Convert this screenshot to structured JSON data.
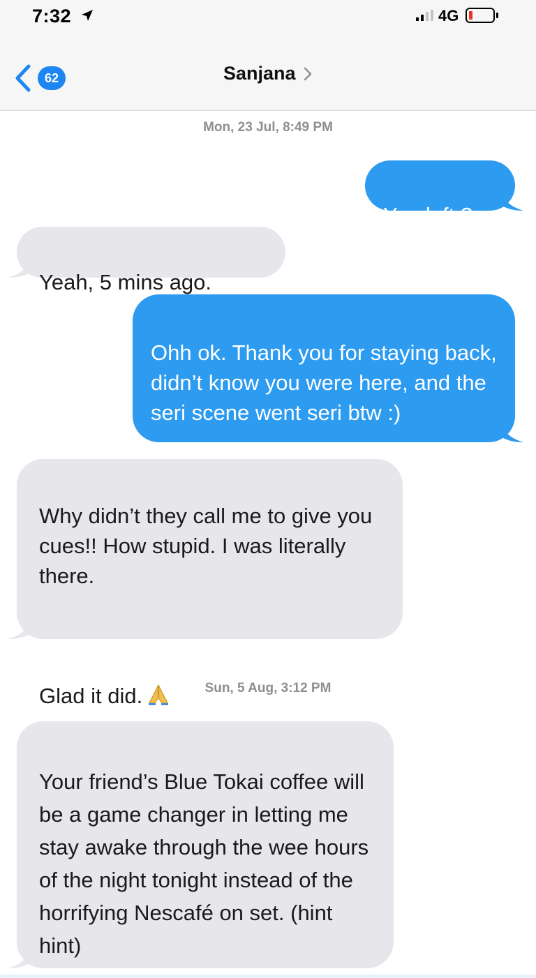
{
  "status_bar": {
    "time": "7:32",
    "network": "4G"
  },
  "header": {
    "back_badge": "62",
    "contact_name": "Sanjana"
  },
  "conversation": [
    {
      "type": "timestamp",
      "text": "Mon, 23 Jul, 8:49 PM"
    },
    {
      "type": "outgoing",
      "text": "You left ?"
    },
    {
      "type": "incoming",
      "text": "Yeah, 5 mins ago."
    },
    {
      "type": "outgoing",
      "text": "Ohh ok. Thank you for staying back, didn’t know you were here, and the seri scene went seri btw :)"
    },
    {
      "type": "incoming",
      "text": "Why didn’t they call me to give you cues!! How stupid. I was literally there.",
      "text_2": "Glad it did.",
      "emoji": "folded-hands"
    },
    {
      "type": "timestamp",
      "text": "Sun, 5 Aug, 3:12 PM"
    },
    {
      "type": "incoming",
      "text": "Your friend’s Blue Tokai coffee will be a game changer in letting me stay awake through the wee hours of the night tonight instead of the horrifying Nescafé on set.  (hint hint)"
    }
  ],
  "colors": {
    "outgoing_bubble": "#2d9bf0",
    "incoming_bubble": "#e6e6eb",
    "badge": "#1d86f2",
    "timestamp": "#8e8e93",
    "battery_low": "#e8332b"
  }
}
